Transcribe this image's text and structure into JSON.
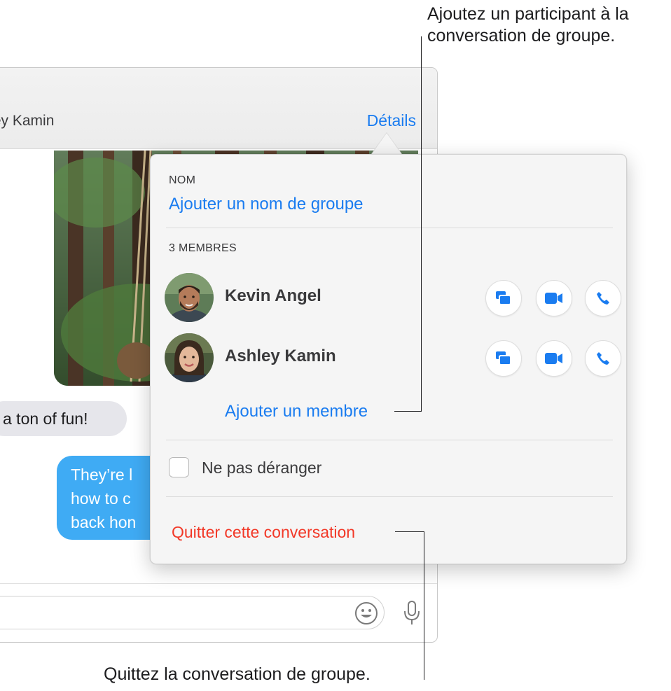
{
  "header": {
    "recipient_partial": "Ashley Kamin",
    "details_label": "Détails"
  },
  "conversation": {
    "incoming_message": "a ton of fun!",
    "outgoing_lines": [
      "They’re l",
      "how to c",
      "back hon"
    ]
  },
  "details_popover": {
    "name_section_label": "NOM",
    "add_group_name_label": "Ajouter un nom de groupe",
    "members_section_label": "3 MEMBRES",
    "members": [
      {
        "name": "Kevin Angel"
      },
      {
        "name": "Ashley Kamin"
      }
    ],
    "add_member_label": "Ajouter un membre",
    "do_not_disturb_label": "Ne pas déranger",
    "do_not_disturb_checked": false,
    "leave_conversation_label": "Quitter cette conversation"
  },
  "callouts": {
    "add_participant_line1": "Ajoutez un participant à la",
    "add_participant_line2": "conversation de groupe.",
    "leave_group": "Quittez la conversation de groupe."
  },
  "colors": {
    "accent_blue": "#1a7cf0",
    "destructive_red": "#f23827",
    "outgoing_bubble": "#3fabf4",
    "incoming_bubble": "#e6e6eb"
  },
  "icons": {
    "message": "message-icon",
    "video": "video-camera-icon",
    "phone": "phone-icon",
    "emoji": "emoji-icon",
    "microphone": "microphone-icon"
  }
}
